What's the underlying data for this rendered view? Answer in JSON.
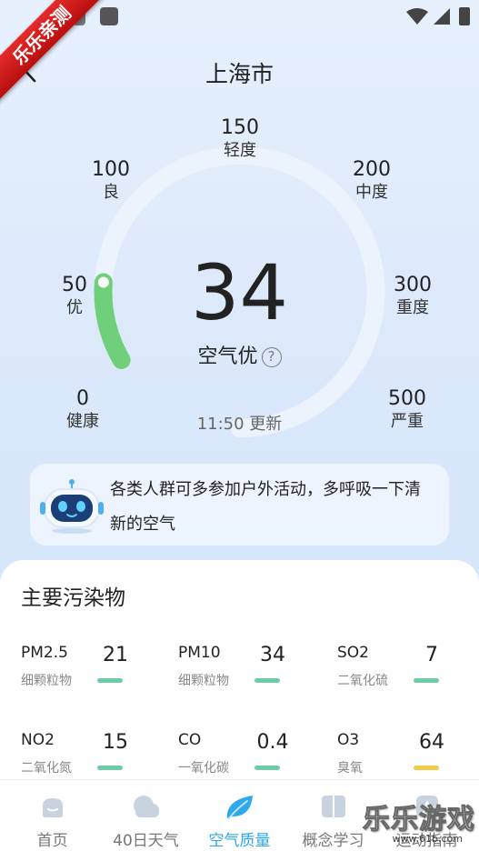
{
  "watermark_ribbon": "乐乐亲测",
  "header": {
    "title": "上海市"
  },
  "gauge": {
    "ticks": [
      {
        "value": "0",
        "level": "健康"
      },
      {
        "value": "50",
        "level": "优"
      },
      {
        "value": "100",
        "level": "良"
      },
      {
        "value": "150",
        "level": "轻度"
      },
      {
        "value": "200",
        "level": "中度"
      },
      {
        "value": "300",
        "level": "重度"
      },
      {
        "value": "500",
        "level": "严重"
      }
    ],
    "aqi": "34",
    "quality": "空气优",
    "help": "?",
    "updated": "11:50 更新",
    "progress_color": "#6fcf7a",
    "track_color": "#ecf3fd"
  },
  "advice": {
    "text": "各类人群可多参加户外活动，多呼吸一下清新的空气",
    "icon": "robot-icon"
  },
  "pollutants": {
    "title": "主要污染物",
    "items": [
      {
        "name": "PM2.5",
        "desc": "细颗粒物",
        "value": "21",
        "color": "#6ccca4"
      },
      {
        "name": "PM10",
        "desc": "细颗粒物",
        "value": "34",
        "color": "#6ccca4"
      },
      {
        "name": "SO2",
        "desc": "二氧化硫",
        "value": "7",
        "color": "#6ccca4"
      },
      {
        "name": "NO2",
        "desc": "二氧化氮",
        "value": "15",
        "color": "#6ccca4"
      },
      {
        "name": "CO",
        "desc": "一氧化碳",
        "value": "0.4",
        "color": "#6ccca4"
      },
      {
        "name": "O3",
        "desc": "臭氧",
        "value": "64",
        "color": "#f2cb4d"
      }
    ]
  },
  "tabs": [
    {
      "label": "首页",
      "icon": "home-icon",
      "active": false
    },
    {
      "label": "40日天气",
      "icon": "cloud-icon",
      "active": false
    },
    {
      "label": "空气质量",
      "icon": "leaf-icon",
      "active": true
    },
    {
      "label": "概念学习",
      "icon": "book-icon",
      "active": false
    },
    {
      "label": "运动指南",
      "icon": "sport-icon",
      "active": false
    }
  ],
  "watermark_corner": {
    "text": "乐乐游戏",
    "url": "www.61b.com"
  },
  "accent_color": "#2ea8ec"
}
